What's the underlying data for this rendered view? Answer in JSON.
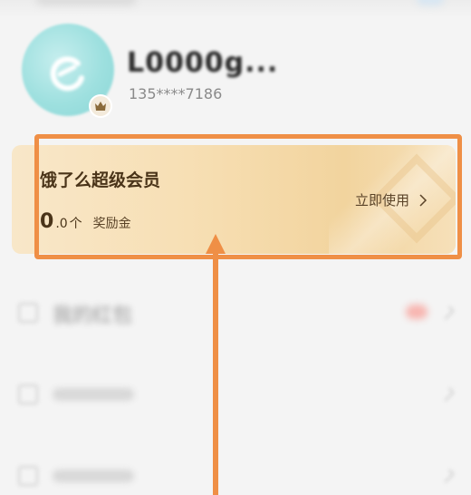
{
  "profile": {
    "username": "L0000g...",
    "phone": "135****7186"
  },
  "vip_card": {
    "title": "饿了么超级会员",
    "reward_count": "0",
    "reward_decimal": ".0",
    "reward_unit": "个",
    "reward_label": "奖励金",
    "action_label": "立即使用"
  },
  "menu": {
    "items": [
      {
        "label": "我的红包"
      }
    ]
  },
  "colors": {
    "highlight": "#ef8f46",
    "card_gradient_start": "#f8e7c9",
    "card_gradient_end": "#f2d49e",
    "card_text": "#4a3419"
  }
}
